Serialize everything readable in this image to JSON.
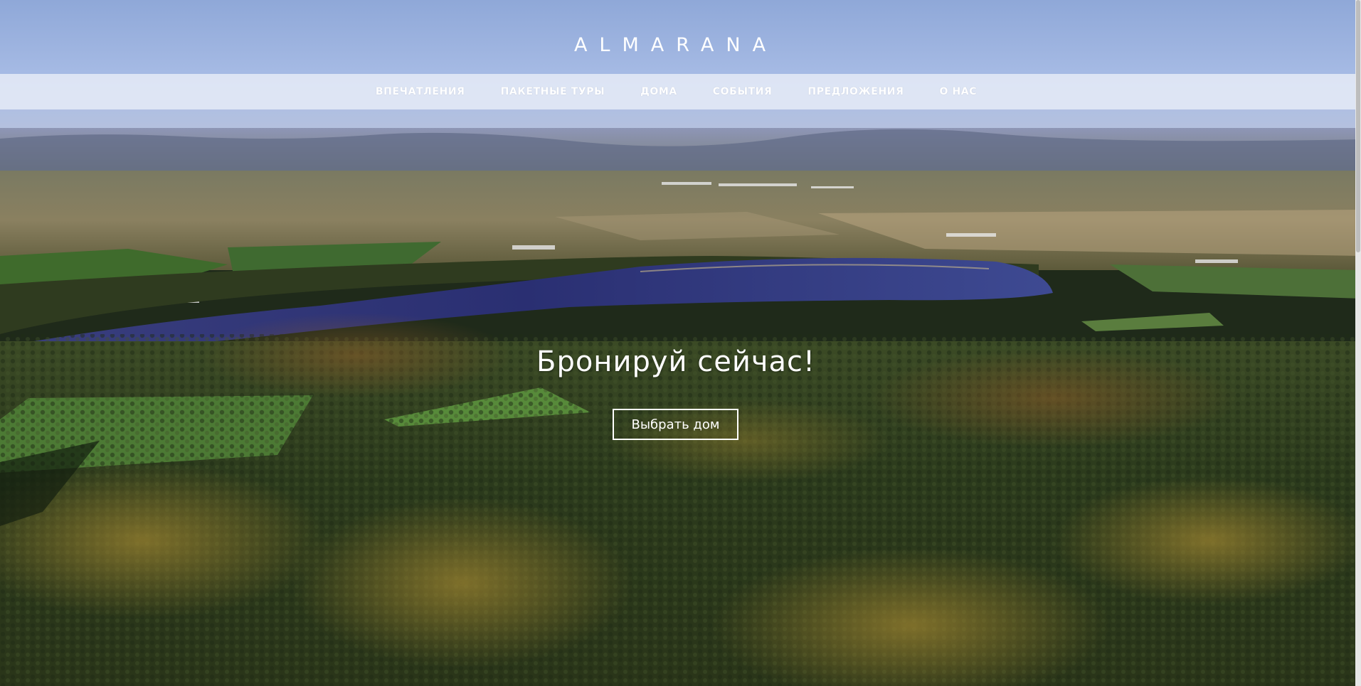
{
  "brand": {
    "logo_text": "ALMARANA"
  },
  "nav": {
    "items": [
      {
        "label": "ВПЕЧАТЛЕНИЯ"
      },
      {
        "label": "ПАКЕТНЫЕ ТУРЫ"
      },
      {
        "label": "ДОМА"
      },
      {
        "label": "СОБЫТИЯ"
      },
      {
        "label": "ПРЕДЛОЖЕНИЯ"
      },
      {
        "label": "О НАС"
      }
    ]
  },
  "hero": {
    "title": "Бронируй сейчас!",
    "button_label": "Выбрать дом",
    "background": "aerial-forest-lake-landscape"
  },
  "colors": {
    "sky": "#a8bde4",
    "nav_band": "#eef1f8",
    "lake": "#2b3274",
    "forest": "#2c3b1e",
    "text": "#ffffff"
  }
}
